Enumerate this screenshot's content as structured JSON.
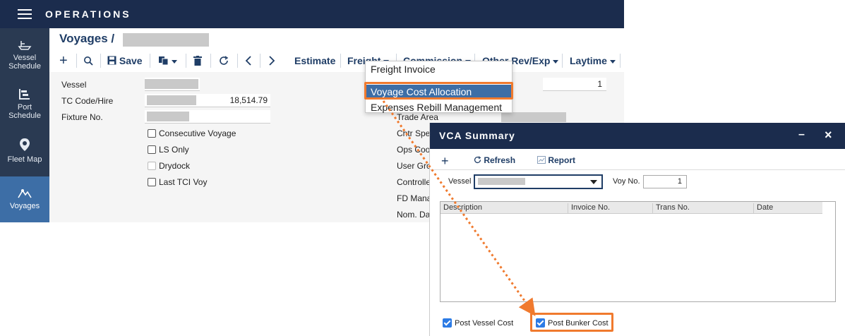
{
  "app": {
    "title": "OPERATIONS"
  },
  "sidebar": {
    "items": [
      {
        "label": "Vessel Schedule",
        "line1": "Vessel",
        "line2": "Schedule",
        "icon": "ship-icon"
      },
      {
        "label": "Port Schedule",
        "line1": "Port",
        "line2": "Schedule",
        "icon": "gantt-icon"
      },
      {
        "label": "Fleet Map",
        "line1": "Fleet Map",
        "line2": "",
        "icon": "map-pin-icon"
      },
      {
        "label": "Voyages",
        "line1": "Voyages",
        "line2": "",
        "icon": "route-icon",
        "active": true
      }
    ]
  },
  "breadcrumb": {
    "root": "Voyages /"
  },
  "toolbar": {
    "save": "Save",
    "estimate": "Estimate",
    "freight": "Freight",
    "commission": "Commission",
    "other": "Other Rev/Exp",
    "laytime": "Laytime"
  },
  "form": {
    "vessel_label": "Vessel",
    "tc_label": "TC Code/Hire",
    "tc_value": "18,514.79",
    "fixture_label": "Fixture No.",
    "consecutive": "Consecutive Voyage",
    "ls_only": "LS Only",
    "drydock": "Drydock",
    "last_tci": "Last TCI Voy",
    "right_value": "1",
    "trade_area": "Trade Area",
    "chtr_spec": "Chtr Spe",
    "ops_coord": "Ops Coo",
    "user_group": "User Gro",
    "controller": "Controlle",
    "fd_manager": "FD Mana",
    "nom_date": "Nom. Da"
  },
  "dropdown": {
    "items": [
      "Freight Invoice",
      "Voyage Cost Allocation",
      "Expenses Rebill Management"
    ]
  },
  "dialog": {
    "title": "VCA Summary",
    "minimize": "–",
    "close": "×",
    "refresh": "Refresh",
    "report": "Report",
    "vessel_label": "Vessel",
    "voy_label": "Voy No.",
    "voy_value": "1",
    "columns": [
      "Description",
      "Invoice No.",
      "Trans No.",
      "Date"
    ],
    "post_vessel_cost": "Post Vessel Cost",
    "post_bunker_cost": "Post Bunker Cost"
  },
  "colors": {
    "navy": "#1b2c4d",
    "accent": "#3d6ea6",
    "highlight": "#f07a2e",
    "checkbox": "#2c7be5"
  }
}
